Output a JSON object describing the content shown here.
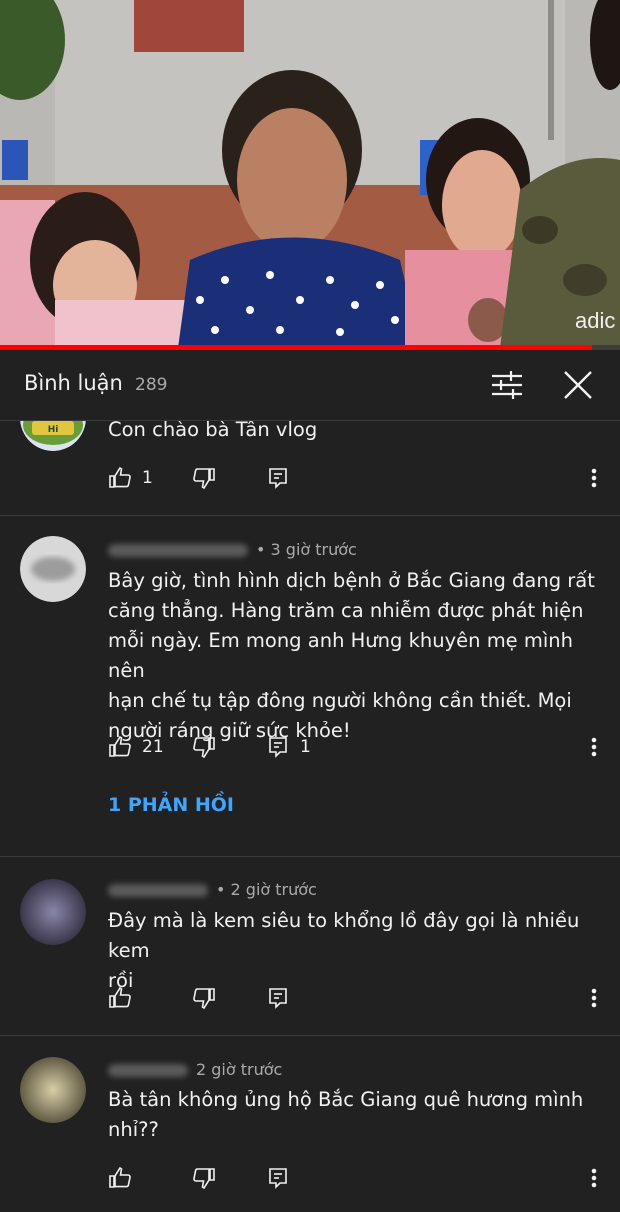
{
  "video": {
    "progress_fraction": 0.955
  },
  "header": {
    "title": "Bình luận",
    "count": "289",
    "filter_icon": "tune-icon",
    "close_icon": "close-icon"
  },
  "colors": {
    "background": "#212121",
    "accent_link": "#3ea6ff",
    "progress": "#ff0000",
    "meta_text": "#aaaaaa"
  },
  "comments": [
    {
      "time": "",
      "text": "Con chào bà Tân vlog",
      "likes": "1",
      "replies_count": ""
    },
    {
      "time": "• 3 giờ trước",
      "text": "Bây giờ, tình hình dịch bệnh ở Bắc Giang đang rất\ncăng thẳng. Hàng trăm ca nhiễm được phát hiện\nmỗi ngày. Em mong anh Hưng khuyên mẹ mình nên\nhạn chế tụ tập đông người không cần thiết. Mọi\nngười ráng giữ sức khỏe!",
      "likes": "21",
      "replies_count": "1",
      "replies_link": "1 PHẢN HỒI"
    },
    {
      "time": "• 2 giờ trước",
      "text": "Đây mà là kem siêu to khổng lồ đây gọi là nhiều kem\nrồi",
      "likes": "",
      "replies_count": ""
    },
    {
      "time": "2 giờ trước",
      "text": "Bà tân không ủng hộ Bắc Giang quê hương mình\nnhỉ??",
      "likes": "",
      "replies_count": ""
    }
  ]
}
